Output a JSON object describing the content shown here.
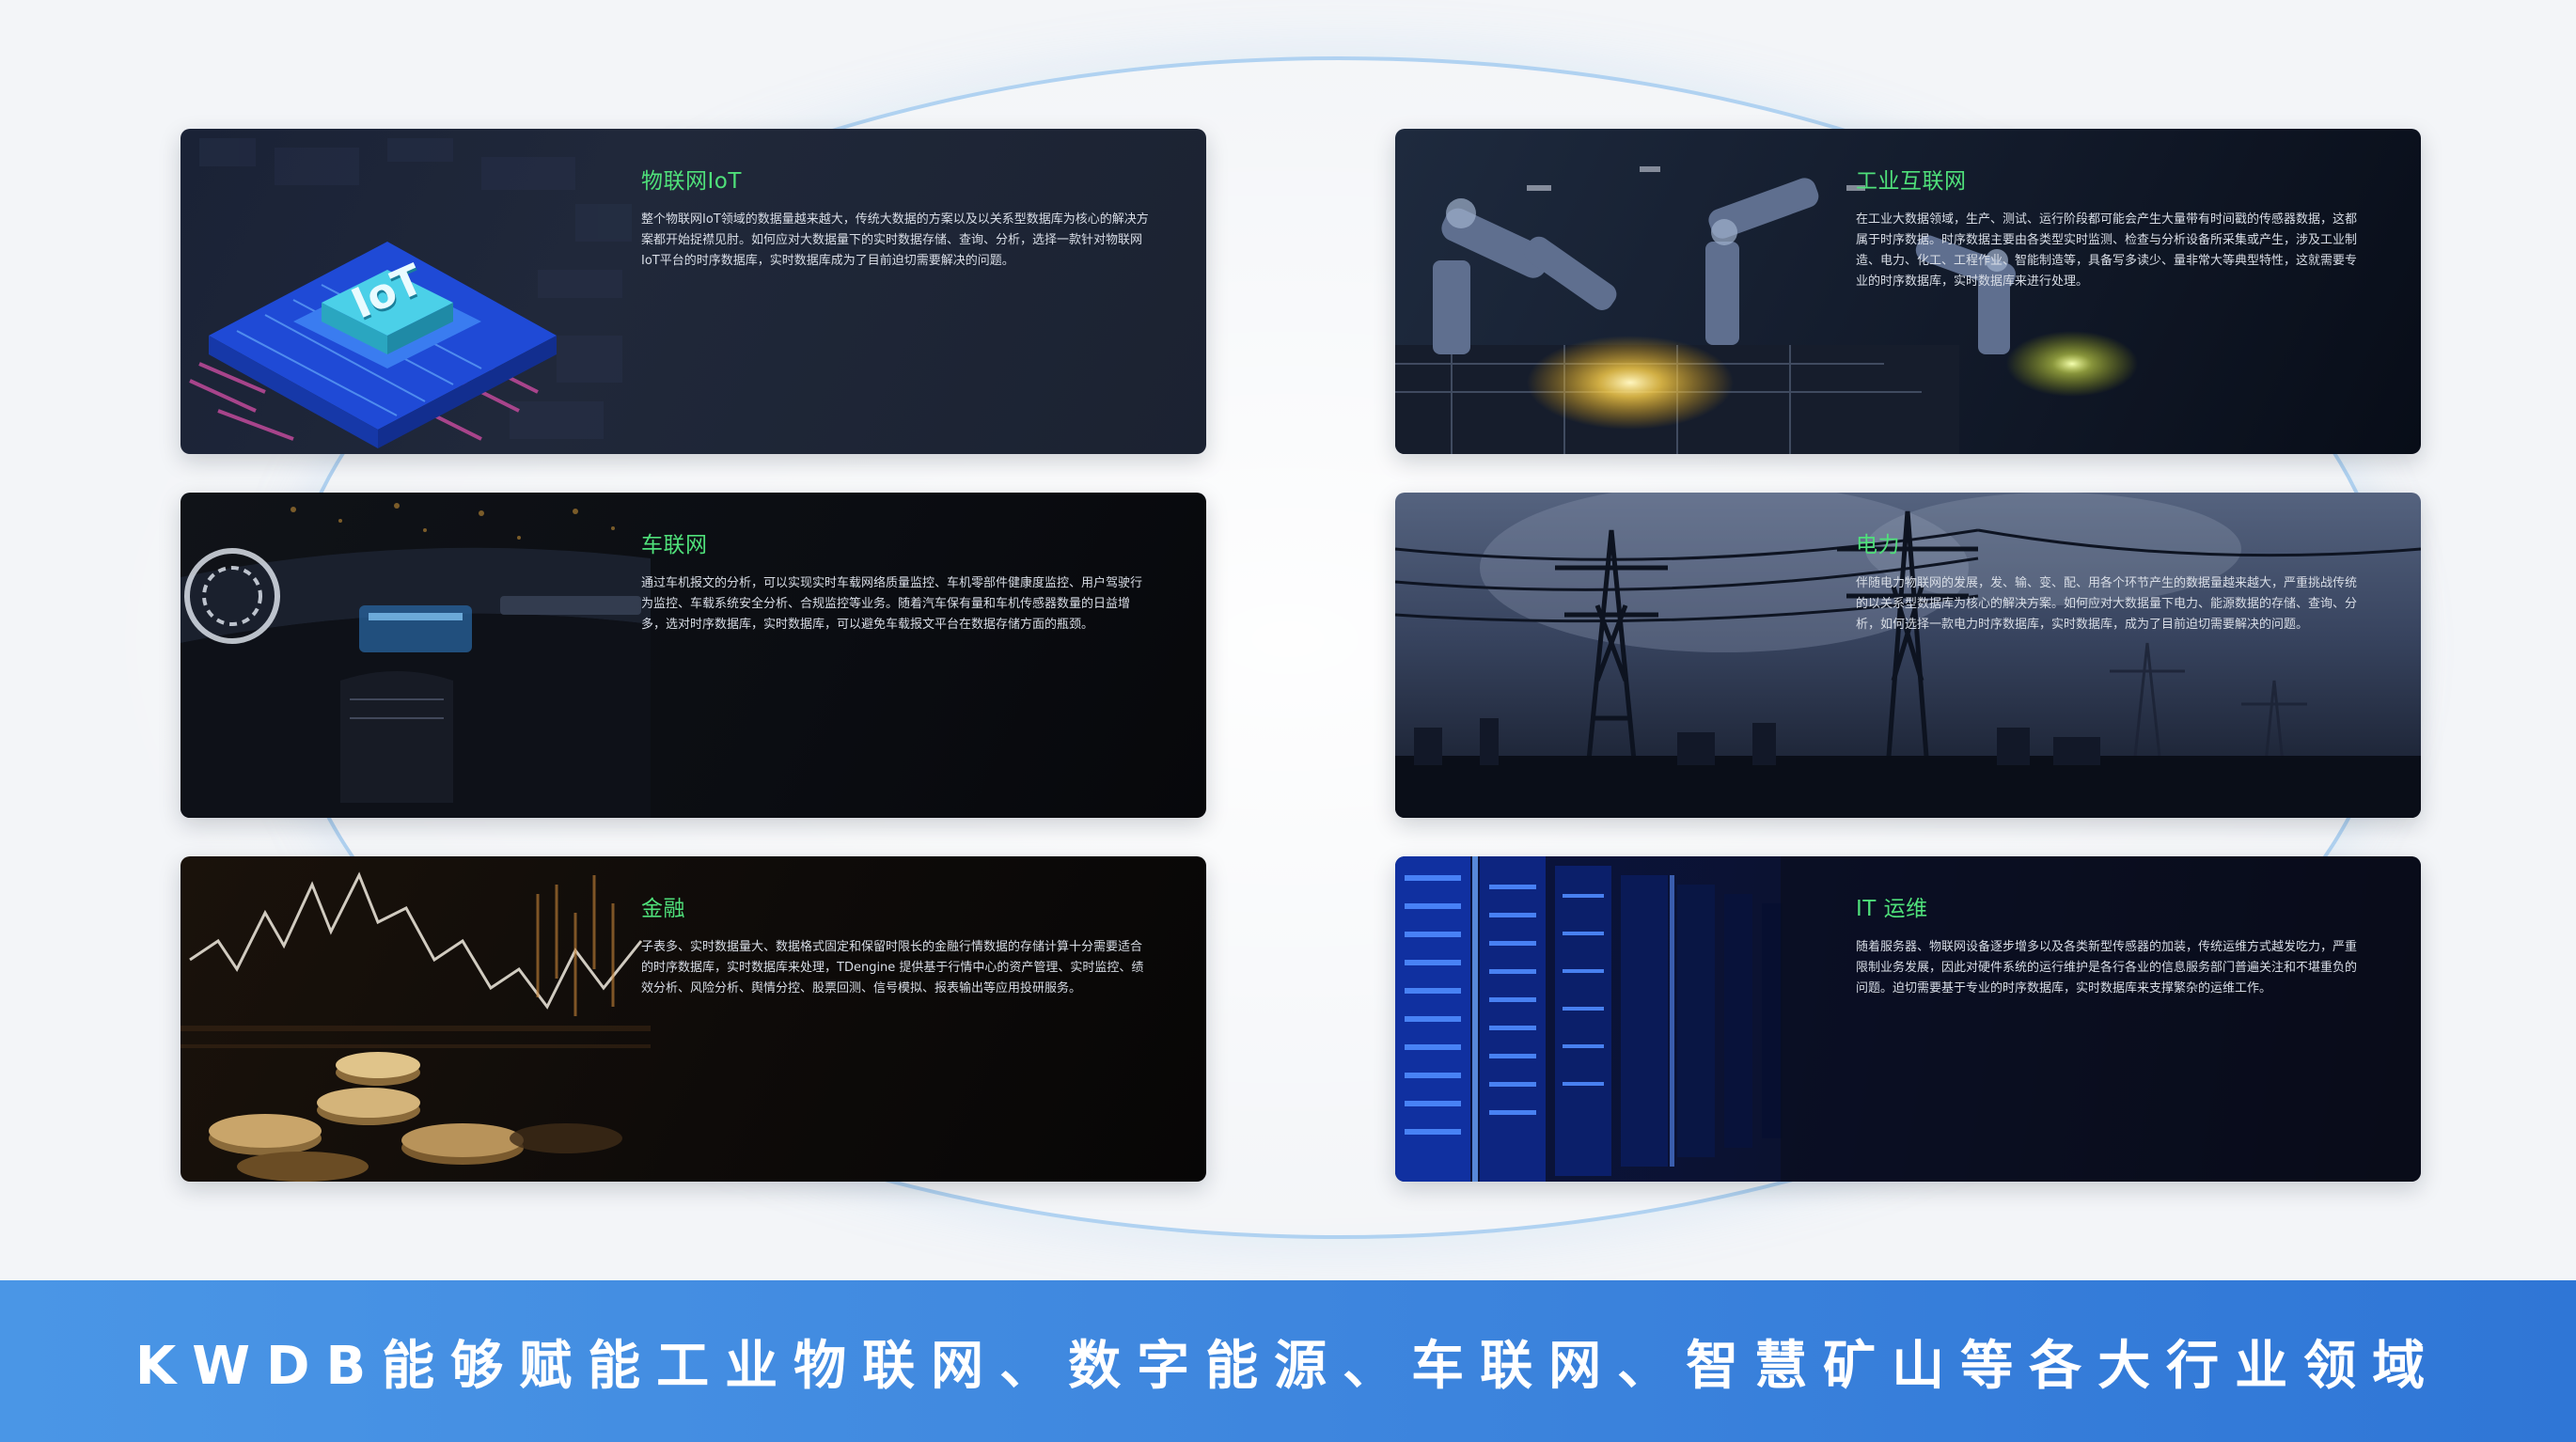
{
  "cards": [
    {
      "id": "iot",
      "title": "物联网IoT",
      "text": "整个物联网IoT领域的数据量越来越大，传统大数据的方案以及以关系型数据库为核心的解决方案都开始捉襟见肘。如何应对大数据量下的实时数据存储、查询、分析，选择一款针对物联网IoT平台的时序数据库，实时数据库成为了目前迫切需要解决的问题。",
      "chip_label": "IoT"
    },
    {
      "id": "industrial",
      "title": "工业互联网",
      "text": "在工业大数据领域，生产、测试、运行阶段都可能会产生大量带有时间戳的传感器数据，这都属于时序数据。时序数据主要由各类型实时监测、检查与分析设备所采集或产生，涉及工业制造、电力、化工、工程作业、智能制造等，具备写多读少、量非常大等典型特性，这就需要专业的时序数据库，实时数据库来进行处理。"
    },
    {
      "id": "vehicle",
      "title": "车联网",
      "text": "通过车机报文的分析，可以实现实时车载网络质量监控、车机零部件健康度监控、用户驾驶行为监控、车载系统安全分析、合规监控等业务。随着汽车保有量和车机传感器数量的日益增多，选对时序数据库，实时数据库，可以避免车载报文平台在数据存储方面的瓶颈。"
    },
    {
      "id": "power",
      "title": "电力",
      "text": "伴随电力物联网的发展，发、输、变、配、用各个环节产生的数据量越来越大，严重挑战传统的以关系型数据库为核心的解决方案。如何应对大数据量下电力、能源数据的存储、查询、分析，如何选择一款电力时序数据库，实时数据库，成为了目前迫切需要解决的问题。"
    },
    {
      "id": "finance",
      "title": "金融",
      "text": "子表多、实时数据量大、数据格式固定和保留时限长的金融行情数据的存储计算十分需要适合的时序数据库，实时数据库来处理，TDengine 提供基于行情中心的资产管理、实时监控、绩效分析、风险分析、舆情分控、股票回测、信号模拟、报表输出等应用投研服务。"
    },
    {
      "id": "itops",
      "title": "IT 运维",
      "text": "随着服务器、物联网设备逐步增多以及各类新型传感器的加装，传统运维方式越发吃力，严重限制业务发展，因此对硬件系统的运行维护是各行各业的信息服务部门普遍关注和不堪重负的问题。迫切需要基于专业的时序数据库，实时数据库来支撑繁杂的运维工作。"
    }
  ],
  "banner": {
    "text": "KWDB能够赋能工业物联网、数字能源、车联网、智慧矿山等各大行业领域"
  },
  "colors": {
    "title_green": "#4fe07a",
    "banner_blue": "#3e86de",
    "page_bg": "#f3f5f8"
  }
}
